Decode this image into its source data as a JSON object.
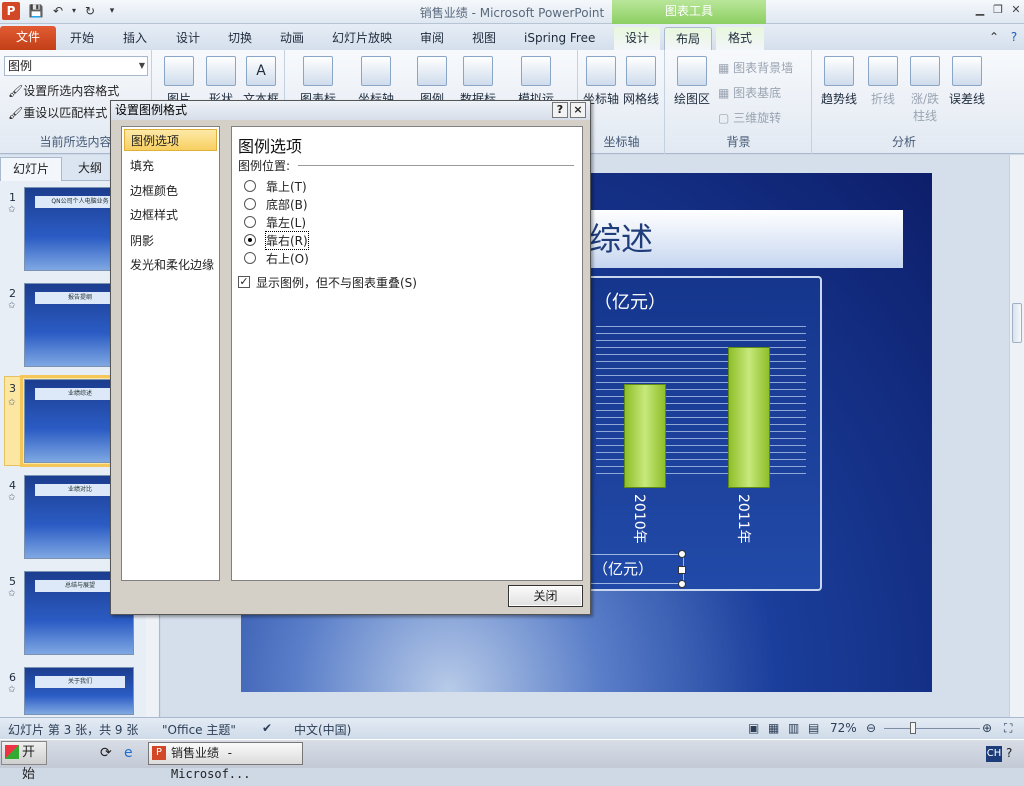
{
  "window": {
    "title": "销售业绩 - Microsoft PowerPoint",
    "context_tools": "图表工具",
    "logo": "P"
  },
  "tabs": [
    "文件",
    "开始",
    "插入",
    "设计",
    "切换",
    "动画",
    "幻灯片放映",
    "审阅",
    "视图",
    "iSpring Free",
    "设计",
    "布局",
    "格式"
  ],
  "ribbon": {
    "selection_combo": "图例",
    "format_selection": "设置所选内容格式",
    "reset_style": "重设以匹配样式",
    "group_current": "当前所选内容",
    "labels_partial": {
      "picture": "图片",
      "shapes": "形状",
      "textbox": "文本框"
    },
    "label_buttons": [
      "图表标题",
      "坐标轴标题",
      "图例",
      "数据标签",
      "模拟运算表"
    ],
    "axes_group": "坐标轴",
    "axes_label": "坐标轴",
    "gridlines": "网格线",
    "bg_group": "背景",
    "plot_area": "绘图区",
    "chart_wall": "图表背景墙",
    "chart_floor": "图表基底",
    "rotation_3d": "三维旋转",
    "analysis_group": "分析",
    "trendline": "趋势线",
    "lines": "折线",
    "updown_bars": "涨/跌柱线",
    "error_bars": "误差线"
  },
  "left_panel": {
    "tab_slides": "幻灯片",
    "tab_outline": "大纲",
    "slides": [
      {
        "num": "1",
        "title": "QN公司个人电脑业务"
      },
      {
        "num": "2",
        "title": "报告提纲"
      },
      {
        "num": "3",
        "title": "业绩综述"
      },
      {
        "num": "4",
        "title": "业绩对比"
      },
      {
        "num": "5",
        "title": "总结与展望"
      },
      {
        "num": "6",
        "title": "关于我们"
      }
    ]
  },
  "slide": {
    "title_visible": "综述",
    "chart_unit": "（亿元）",
    "bars": [
      {
        "label": "2010年",
        "value": 0.72
      },
      {
        "label": "2011年",
        "value": 0.97
      }
    ],
    "legend_text": "（亿元）"
  },
  "dialog": {
    "title": "设置图例格式",
    "help": "?",
    "close_x": "×",
    "nav": [
      "图例选项",
      "填充",
      "边框颜色",
      "边框样式",
      "阴影",
      "发光和柔化边缘"
    ],
    "heading": "图例选项",
    "position_label": "图例位置:",
    "options": [
      "靠上(T)",
      "底部(B)",
      "靠左(L)",
      "靠右(R)",
      "右上(O)"
    ],
    "selected": "靠右(R)",
    "show_no_overlap": "显示图例，但不与图表重叠(S)",
    "close_button": "关闭"
  },
  "status": {
    "slide_info": "幻灯片 第 3 张，共 9 张",
    "theme": "\"Office 主题\"",
    "language": "中文(中国)",
    "zoom": "72%"
  },
  "taskbar": {
    "start": "开始",
    "app": "销售业绩 - Microsof...",
    "ime": "CH"
  }
}
